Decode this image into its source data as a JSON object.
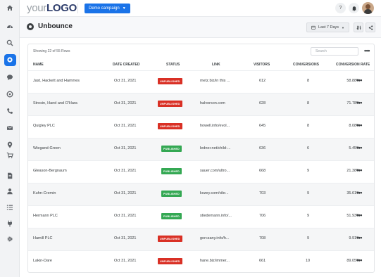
{
  "sidebar": {
    "items": [
      {
        "icon": "home-icon"
      },
      {
        "icon": "dashboard-icon"
      },
      {
        "icon": "search-icon"
      },
      {
        "icon": "target-icon",
        "active": true
      },
      {
        "icon": "chat-icon"
      },
      {
        "icon": "whatsapp-icon"
      },
      {
        "icon": "phone-icon"
      },
      {
        "icon": "mail-icon"
      },
      {
        "icon": "location-icon"
      },
      {
        "icon": "cart-icon"
      },
      {
        "icon": "document-icon"
      },
      {
        "icon": "user-icon"
      },
      {
        "icon": "list-icon"
      },
      {
        "icon": "plug-icon"
      },
      {
        "icon": "settings-icon"
      }
    ]
  },
  "header": {
    "logo_prefix": "your",
    "logo_bold": "LOGO",
    "campaign_label": "Demo campaign",
    "help_icon": "?",
    "notification_icon": "bell-icon"
  },
  "page": {
    "title": "Unbounce",
    "range_label": "Last 7 Days",
    "filter_icon": "sliders-icon",
    "share_icon": "share-icon"
  },
  "table": {
    "showing_text": "Showing 22 of 55 Rows",
    "search_placeholder": "Search",
    "more_label": "•••",
    "columns": [
      "NAME",
      "DATE CREATED",
      "STATUS",
      "LINK",
      "VISITORS",
      "CONVERSIONS",
      "CONVERSION RATE"
    ],
    "rows": [
      {
        "name": "Jast, Hackett and Hammes",
        "date": "Oct 31, 2021",
        "status": "UNPUBLISHED",
        "link": "metz.biz/in this ...",
        "visitors": "612",
        "conversions": "8",
        "rate": "58.88%"
      },
      {
        "name": "Strosin, Hand and O'Hara",
        "date": "Oct 31, 2021",
        "status": "UNPUBLISHED",
        "link": "halvorson.com",
        "visitors": "628",
        "conversions": "8",
        "rate": "71.78%"
      },
      {
        "name": "Quigley PLC",
        "date": "Oct 31, 2021",
        "status": "UNPUBLISHED",
        "link": "howell.info/evol...",
        "visitors": "645",
        "conversions": "8",
        "rate": "8.08%"
      },
      {
        "name": "Wiegand-Green",
        "date": "Oct 31, 2021",
        "status": "PUBLISHED",
        "link": "ledner.net/child-...",
        "visitors": "636",
        "conversions": "6",
        "rate": "5.45%"
      },
      {
        "name": "Gleason-Bergnaum",
        "date": "Oct 31, 2021",
        "status": "PUBLISHED",
        "link": "sauer.com/ultro...",
        "visitors": "668",
        "conversions": "9",
        "rate": "21.38%"
      },
      {
        "name": "Kuhn-Cremin",
        "date": "Oct 31, 2021",
        "status": "PUBLISHED",
        "link": "kozey.com/vibr...",
        "visitors": "703",
        "conversions": "9",
        "rate": "35.61%"
      },
      {
        "name": "Hermann PLC",
        "date": "Oct 31, 2021",
        "status": "PUBLISHED",
        "link": "stiedemann.info/...",
        "visitors": "706",
        "conversions": "9",
        "rate": "51.93%"
      },
      {
        "name": "Hamill PLC",
        "date": "Oct 31, 2021",
        "status": "UNPUBLISHED",
        "link": "gorczany.info/h...",
        "visitors": "708",
        "conversions": "9",
        "rate": "9.91%"
      },
      {
        "name": "Lakin-Dare",
        "date": "Oct 31, 2021",
        "status": "UNPUBLISHED",
        "link": "hane.biz/immer...",
        "visitors": "661",
        "conversions": "10",
        "rate": "89.05%"
      }
    ],
    "row_menu_label": "•••"
  },
  "colors": {
    "accent": "#1a73e8",
    "unpublished": "#d93025",
    "published": "#34a853"
  }
}
